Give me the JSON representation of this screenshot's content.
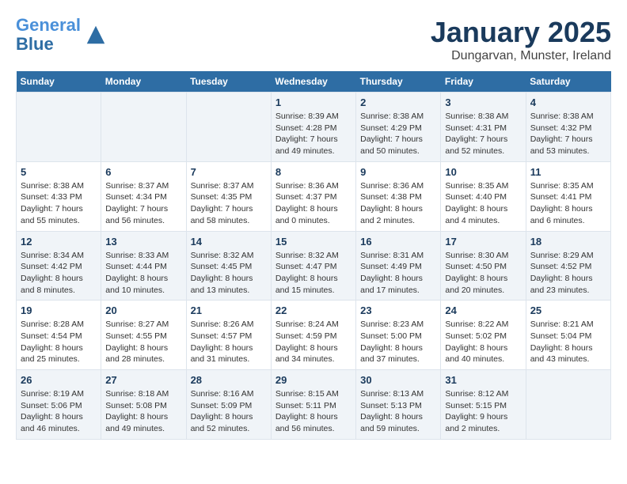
{
  "header": {
    "logo_line1": "General",
    "logo_line2": "Blue",
    "month_title": "January 2025",
    "subtitle": "Dungarvan, Munster, Ireland"
  },
  "days_of_week": [
    "Sunday",
    "Monday",
    "Tuesday",
    "Wednesday",
    "Thursday",
    "Friday",
    "Saturday"
  ],
  "weeks": [
    [
      {
        "day": "",
        "info": ""
      },
      {
        "day": "",
        "info": ""
      },
      {
        "day": "",
        "info": ""
      },
      {
        "day": "1",
        "info": "Sunrise: 8:39 AM\nSunset: 4:28 PM\nDaylight: 7 hours\nand 49 minutes."
      },
      {
        "day": "2",
        "info": "Sunrise: 8:38 AM\nSunset: 4:29 PM\nDaylight: 7 hours\nand 50 minutes."
      },
      {
        "day": "3",
        "info": "Sunrise: 8:38 AM\nSunset: 4:31 PM\nDaylight: 7 hours\nand 52 minutes."
      },
      {
        "day": "4",
        "info": "Sunrise: 8:38 AM\nSunset: 4:32 PM\nDaylight: 7 hours\nand 53 minutes."
      }
    ],
    [
      {
        "day": "5",
        "info": "Sunrise: 8:38 AM\nSunset: 4:33 PM\nDaylight: 7 hours\nand 55 minutes."
      },
      {
        "day": "6",
        "info": "Sunrise: 8:37 AM\nSunset: 4:34 PM\nDaylight: 7 hours\nand 56 minutes."
      },
      {
        "day": "7",
        "info": "Sunrise: 8:37 AM\nSunset: 4:35 PM\nDaylight: 7 hours\nand 58 minutes."
      },
      {
        "day": "8",
        "info": "Sunrise: 8:36 AM\nSunset: 4:37 PM\nDaylight: 8 hours\nand 0 minutes."
      },
      {
        "day": "9",
        "info": "Sunrise: 8:36 AM\nSunset: 4:38 PM\nDaylight: 8 hours\nand 2 minutes."
      },
      {
        "day": "10",
        "info": "Sunrise: 8:35 AM\nSunset: 4:40 PM\nDaylight: 8 hours\nand 4 minutes."
      },
      {
        "day": "11",
        "info": "Sunrise: 8:35 AM\nSunset: 4:41 PM\nDaylight: 8 hours\nand 6 minutes."
      }
    ],
    [
      {
        "day": "12",
        "info": "Sunrise: 8:34 AM\nSunset: 4:42 PM\nDaylight: 8 hours\nand 8 minutes."
      },
      {
        "day": "13",
        "info": "Sunrise: 8:33 AM\nSunset: 4:44 PM\nDaylight: 8 hours\nand 10 minutes."
      },
      {
        "day": "14",
        "info": "Sunrise: 8:32 AM\nSunset: 4:45 PM\nDaylight: 8 hours\nand 13 minutes."
      },
      {
        "day": "15",
        "info": "Sunrise: 8:32 AM\nSunset: 4:47 PM\nDaylight: 8 hours\nand 15 minutes."
      },
      {
        "day": "16",
        "info": "Sunrise: 8:31 AM\nSunset: 4:49 PM\nDaylight: 8 hours\nand 17 minutes."
      },
      {
        "day": "17",
        "info": "Sunrise: 8:30 AM\nSunset: 4:50 PM\nDaylight: 8 hours\nand 20 minutes."
      },
      {
        "day": "18",
        "info": "Sunrise: 8:29 AM\nSunset: 4:52 PM\nDaylight: 8 hours\nand 23 minutes."
      }
    ],
    [
      {
        "day": "19",
        "info": "Sunrise: 8:28 AM\nSunset: 4:54 PM\nDaylight: 8 hours\nand 25 minutes."
      },
      {
        "day": "20",
        "info": "Sunrise: 8:27 AM\nSunset: 4:55 PM\nDaylight: 8 hours\nand 28 minutes."
      },
      {
        "day": "21",
        "info": "Sunrise: 8:26 AM\nSunset: 4:57 PM\nDaylight: 8 hours\nand 31 minutes."
      },
      {
        "day": "22",
        "info": "Sunrise: 8:24 AM\nSunset: 4:59 PM\nDaylight: 8 hours\nand 34 minutes."
      },
      {
        "day": "23",
        "info": "Sunrise: 8:23 AM\nSunset: 5:00 PM\nDaylight: 8 hours\nand 37 minutes."
      },
      {
        "day": "24",
        "info": "Sunrise: 8:22 AM\nSunset: 5:02 PM\nDaylight: 8 hours\nand 40 minutes."
      },
      {
        "day": "25",
        "info": "Sunrise: 8:21 AM\nSunset: 5:04 PM\nDaylight: 8 hours\nand 43 minutes."
      }
    ],
    [
      {
        "day": "26",
        "info": "Sunrise: 8:19 AM\nSunset: 5:06 PM\nDaylight: 8 hours\nand 46 minutes."
      },
      {
        "day": "27",
        "info": "Sunrise: 8:18 AM\nSunset: 5:08 PM\nDaylight: 8 hours\nand 49 minutes."
      },
      {
        "day": "28",
        "info": "Sunrise: 8:16 AM\nSunset: 5:09 PM\nDaylight: 8 hours\nand 52 minutes."
      },
      {
        "day": "29",
        "info": "Sunrise: 8:15 AM\nSunset: 5:11 PM\nDaylight: 8 hours\nand 56 minutes."
      },
      {
        "day": "30",
        "info": "Sunrise: 8:13 AM\nSunset: 5:13 PM\nDaylight: 8 hours\nand 59 minutes."
      },
      {
        "day": "31",
        "info": "Sunrise: 8:12 AM\nSunset: 5:15 PM\nDaylight: 9 hours\nand 2 minutes."
      },
      {
        "day": "",
        "info": ""
      }
    ]
  ]
}
